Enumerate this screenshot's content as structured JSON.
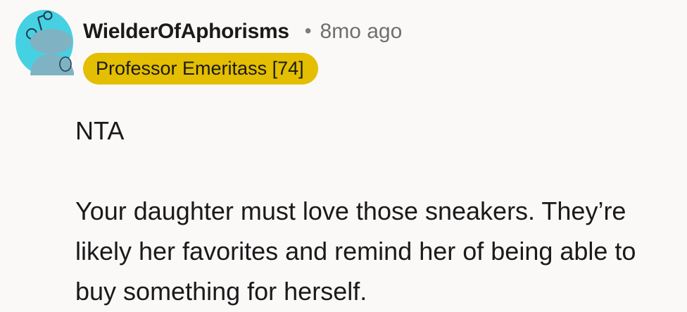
{
  "comment": {
    "username": "WielderOfAphorisms",
    "separator": "•",
    "timestamp": "8mo ago",
    "flair": "Professor Emeritass [74]",
    "avatar_icon": "reddit-snoo-avatar-icon",
    "body": [
      "NTA",
      "Your daughter must love those sneakers. They’re likely her favorites and remind her of being able to buy something for herself."
    ]
  },
  "colors": {
    "background": "#fbf9f8",
    "avatar_bg": "#46d1e3",
    "flair_bg": "#e4be00",
    "text": "#1a1a1b",
    "meta": "#6f6f6f"
  }
}
